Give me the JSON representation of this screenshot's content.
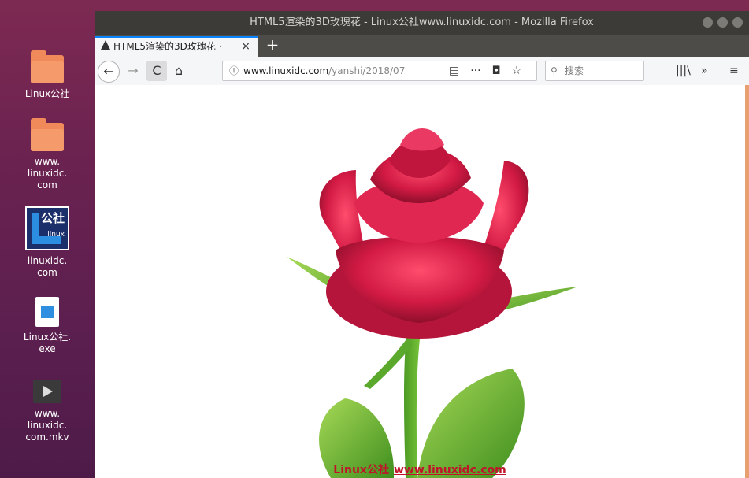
{
  "desktop": {
    "icons": [
      {
        "label": "Linux公社",
        "icon": "folder-icon"
      },
      {
        "label": "www.\nlinuxidc.\ncom",
        "icon": "folder-icon"
      },
      {
        "label": "linuxidc.\ncom",
        "icon": "linuxidc-logo-icon"
      },
      {
        "label": "Linux公社.\nexe",
        "icon": "exe-file-icon"
      },
      {
        "label": "www.\nlinuxidc.\ncom.mkv",
        "icon": "video-file-icon"
      }
    ]
  },
  "browser": {
    "window_title": "HTML5渲染的3D玫瑰花 - Linux公社www.linuxidc.com - Mozilla Firefox",
    "tab_title": "HTML5渲染的3D玫瑰花 ·",
    "tab_close": "×",
    "new_tab": "+",
    "url_domain": "www.linuxidc.com",
    "url_path": "/yanshi/2018/07",
    "search_placeholder": "搜索",
    "icons": {
      "back": "←",
      "forward": "→",
      "reload": "C",
      "home": "⌂",
      "info": "ⓘ",
      "reader": "▤",
      "more": "···",
      "pocket": "◘",
      "star": "☆",
      "search": "🔍",
      "library": "|||\\",
      "overflow": "»",
      "menu": "≡"
    }
  },
  "page": {
    "caption_text": "Linux公社",
    "caption_link": "www.linuxidc.com"
  },
  "colors": {
    "rose_red": "#d21a44",
    "leaf_green": "#6bb237",
    "caption_red": "#c0132a"
  }
}
